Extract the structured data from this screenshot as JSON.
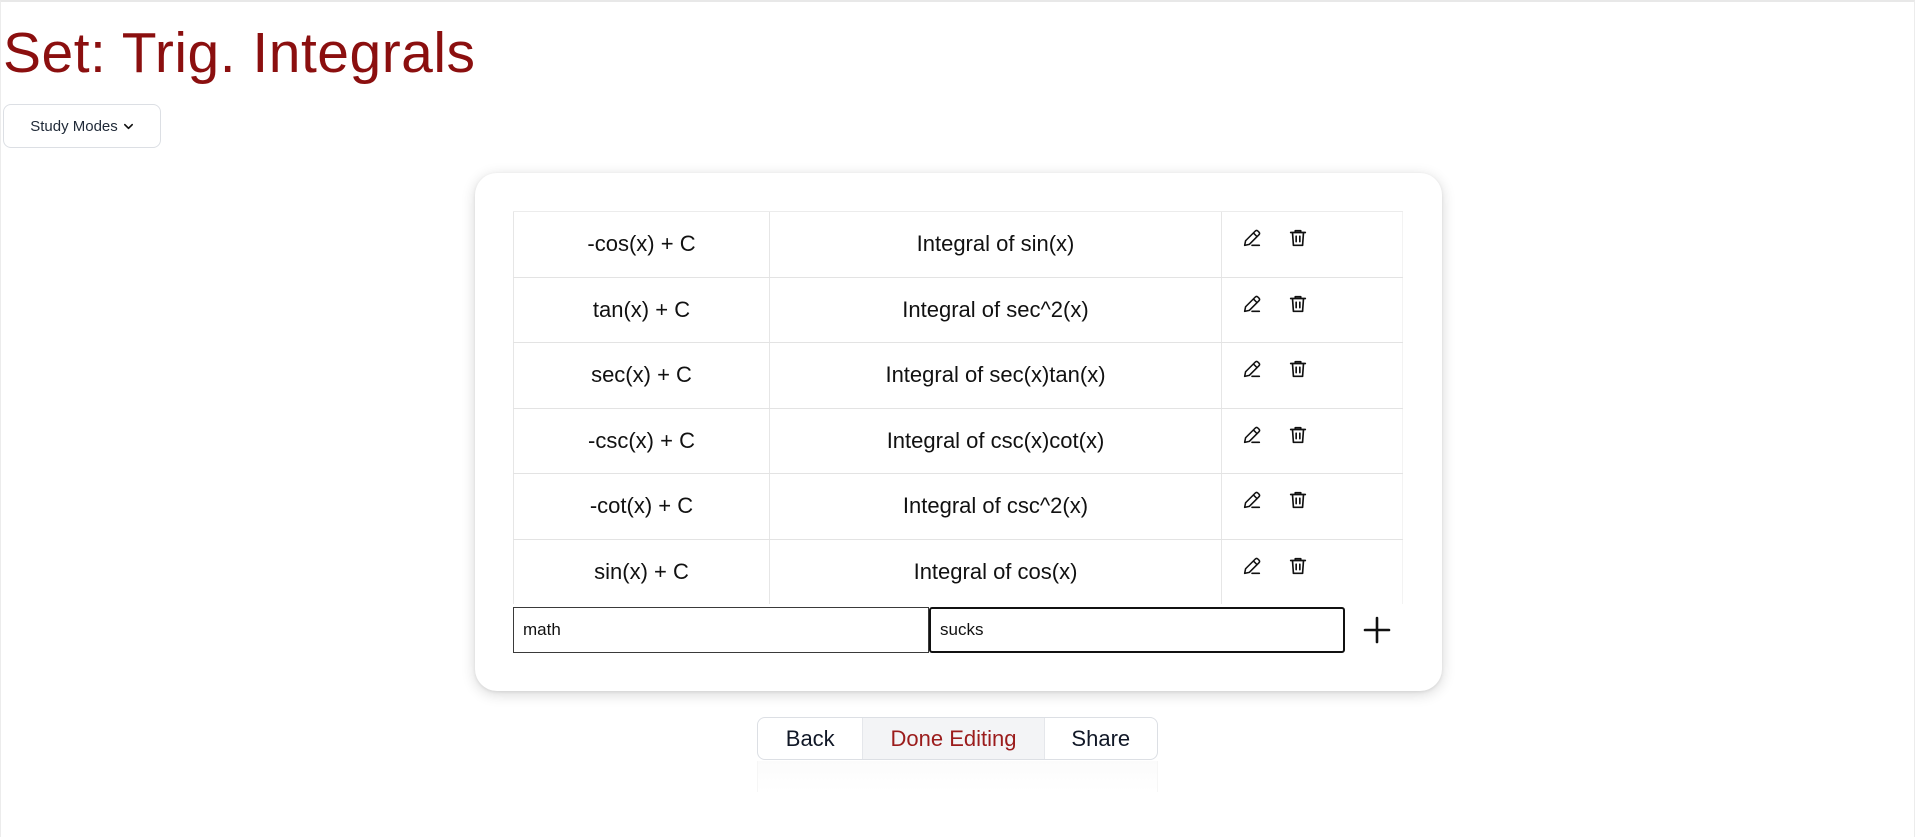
{
  "page": {
    "title": "Set: Trig. Integrals",
    "title_color": "#8b0f0f"
  },
  "study_modes": {
    "label": "Study Modes",
    "icon": "chevron-down-icon"
  },
  "cards": [
    {
      "term": "-cos(x) + C",
      "definition": "Integral of sin(x)"
    },
    {
      "term": "tan(x) + C",
      "definition": "Integral of sec^2(x)"
    },
    {
      "term": "sec(x) + C",
      "definition": "Integral of sec(x)tan(x)"
    },
    {
      "term": "-csc(x) + C",
      "definition": "Integral of csc(x)cot(x)"
    },
    {
      "term": "-cot(x) + C",
      "definition": "Integral of csc^2(x)"
    },
    {
      "term": "sin(x) + C",
      "definition": "Integral of cos(x)"
    }
  ],
  "row_icons": {
    "edit": "pencil-icon",
    "delete": "trash-icon"
  },
  "new_card": {
    "term_value": "math",
    "definition_value": "sucks",
    "add_icon": "plus-icon"
  },
  "footer_buttons": {
    "back": "Back",
    "done": "Done Editing",
    "share": "Share",
    "done_color": "#9b1c1c"
  }
}
